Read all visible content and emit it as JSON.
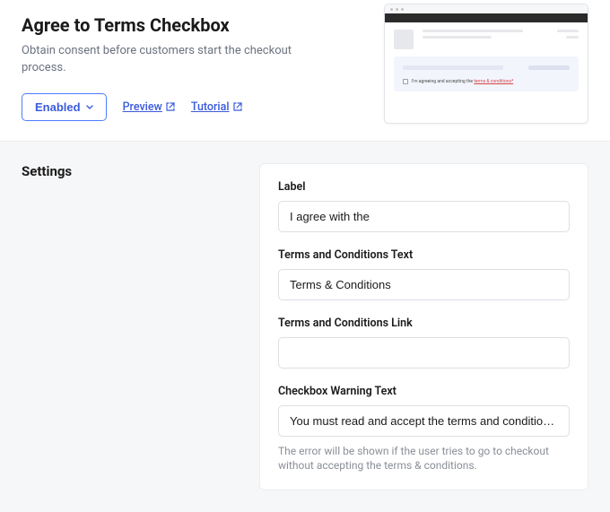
{
  "header": {
    "title": "Agree to Terms Checkbox",
    "subtitle": "Obtain consent before customers start the checkout process.",
    "enabled_label": "Enabled",
    "preview_label": "Preview",
    "tutorial_label": "Tutorial"
  },
  "thumb": {
    "check_prefix": "I'm agreeing and accepting the ",
    "check_link": "terms & conditions*"
  },
  "settings": {
    "heading": "Settings",
    "fields": {
      "label": {
        "label": "Label",
        "value": "I agree with the"
      },
      "terms_text": {
        "label": "Terms and Conditions Text",
        "value": "Terms & Conditions"
      },
      "terms_link": {
        "label": "Terms and Conditions Link",
        "value": ""
      },
      "warning": {
        "label": "Checkbox Warning Text",
        "value": "You must read and accept the terms and conditions to complete checkout",
        "help": "The error will be shown if the user tries to go to checkout without accepting the terms & conditions."
      }
    }
  }
}
